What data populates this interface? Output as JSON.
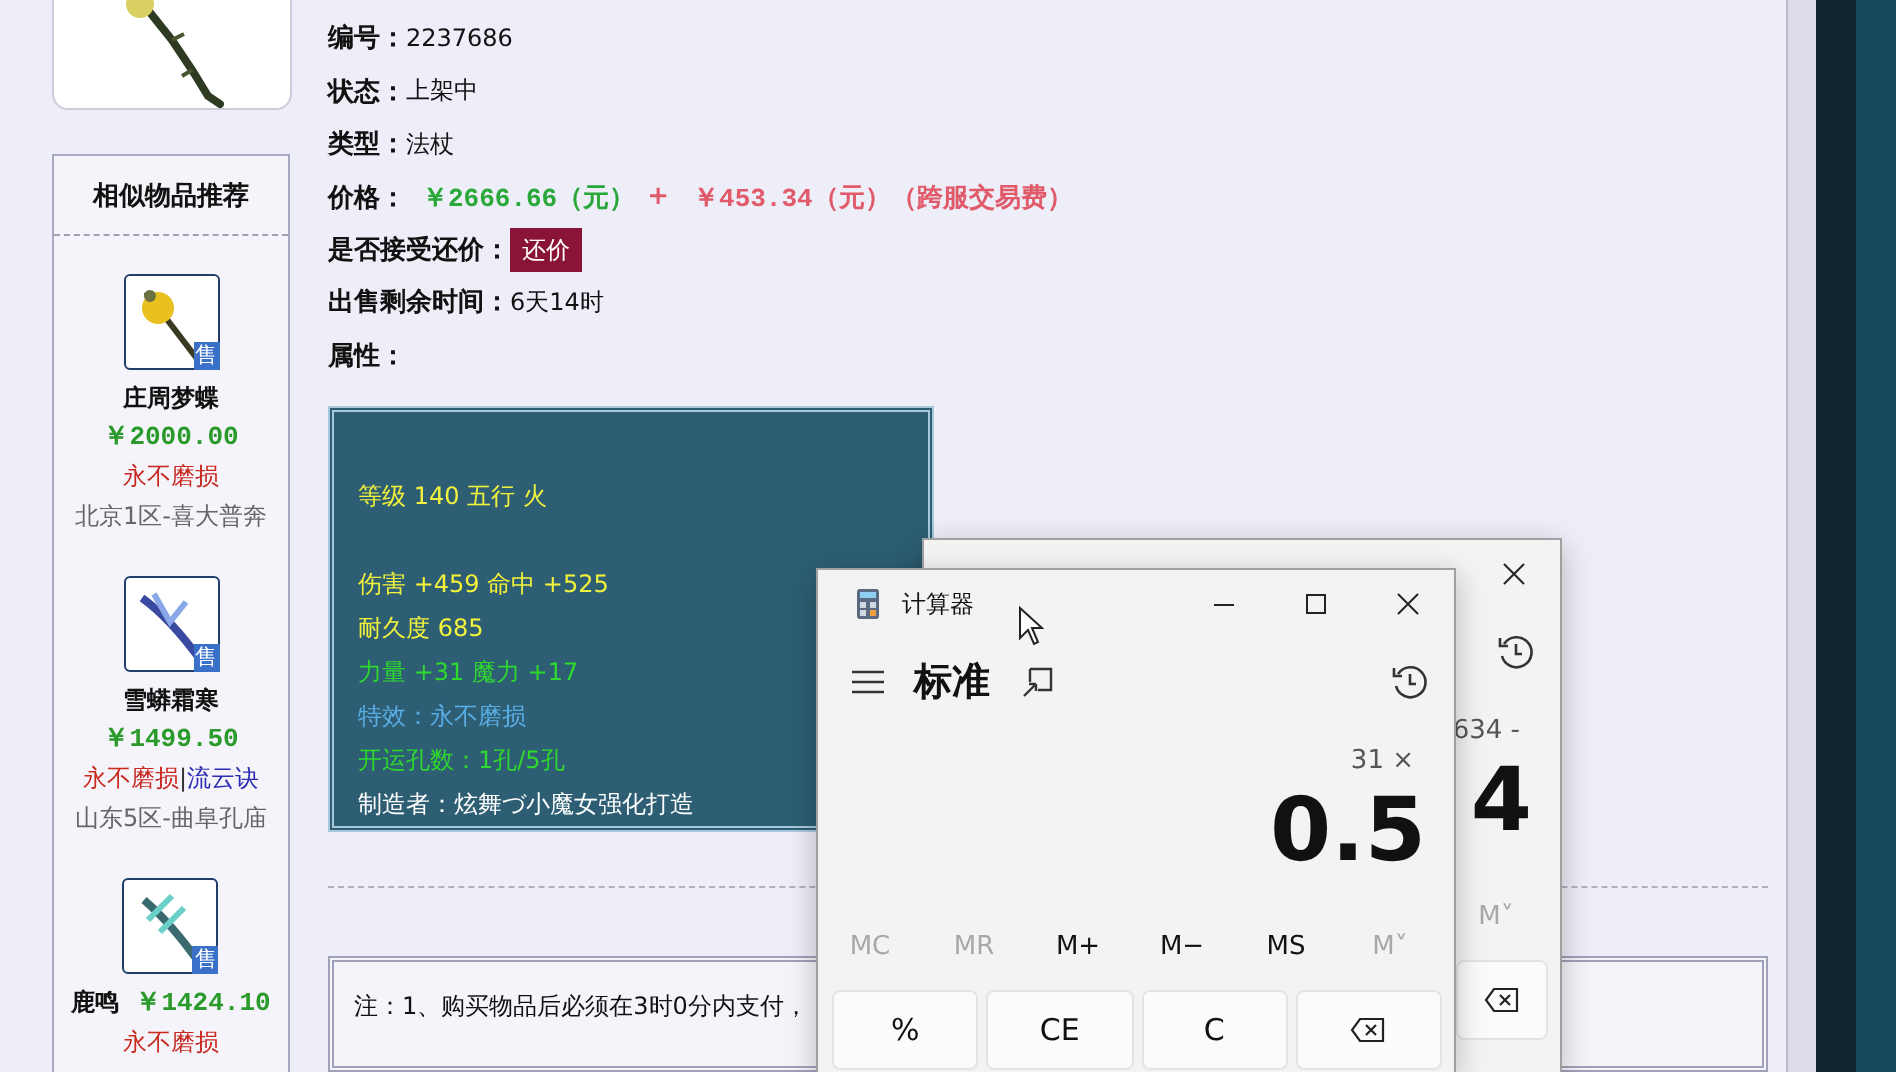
{
  "recommendations": {
    "title": "相似物品推荐",
    "items": [
      {
        "kind": "stacked",
        "name": "庄周梦蝶",
        "price": "￥2000.00",
        "badge": "售",
        "tags": [
          {
            "text": "永不磨损",
            "color": "#c8281e"
          }
        ],
        "server": "北京1区-喜大普奔"
      },
      {
        "kind": "stacked",
        "name": "雪蟒霜寒",
        "price": "￥1499.50",
        "badge": "售",
        "tags": [
          {
            "text": "永不磨损",
            "color": "#c8281e"
          },
          {
            "text": "|",
            "color": "#333333"
          },
          {
            "text": "流云诀",
            "color": "#2b2bb4"
          }
        ],
        "server": "山东5区-曲阜孔庙"
      },
      {
        "kind": "inline",
        "name": "鹿鸣",
        "price": "￥1424.10",
        "badge": "售",
        "tags": [
          {
            "text": "永不磨损",
            "color": "#c8281e"
          }
        ]
      }
    ]
  },
  "details": {
    "fields": [
      {
        "kind": "text",
        "label": "编号：",
        "value": "2237686"
      },
      {
        "kind": "text",
        "label": "状态：",
        "value": " 上架中"
      },
      {
        "kind": "text",
        "label": "类型：",
        "value": "法杖"
      },
      {
        "kind": "price",
        "label": "价格：",
        "price": "￥2666.66（元）",
        "plus": "+",
        "fee": "￥453.34（元）（跨服交易费）"
      },
      {
        "kind": "button",
        "label": "是否接受还价：",
        "button": "还价"
      },
      {
        "kind": "text",
        "label": "出售剩余时间：",
        "value": "6天14时"
      },
      {
        "kind": "label",
        "label": "属性："
      }
    ]
  },
  "attributes": {
    "lines": [
      {
        "text": "等级 140 五行 火",
        "color": "#f2f23c",
        "gap_before": false
      },
      {
        "text": "伤害 +459 命中 +525",
        "color": "#f2f23c",
        "gap_before": true
      },
      {
        "text": "耐久度 685",
        "color": "#f2f23c",
        "gap_before": false
      },
      {
        "text": "力量 +31 魔力 +17",
        "color": "#2ed82e",
        "gap_before": false
      },
      {
        "text": "特效：永不磨损",
        "color": "#5aaee6",
        "gap_before": false
      },
      {
        "text": "开运孔数：1孔/5孔",
        "color": "#2ed82e",
        "gap_before": false
      },
      {
        "text": "制造者：炫舞づ小魔女强化打造",
        "color": "#ffffff",
        "gap_before": false
      }
    ]
  },
  "notes": {
    "lines": [
      "注：1、购买物品后必须在3时0分内支付，"
    ]
  },
  "calculator_back": {
    "expression": "634 -",
    "display": "4",
    "memory": [
      {
        "label": "M˅",
        "disabled": true
      }
    ],
    "keys": [
      {
        "kind": "backspace"
      }
    ]
  },
  "calculator_front": {
    "title": "计算器",
    "mode": "标准",
    "expression": "31 ×",
    "display": "0.5",
    "memory": [
      {
        "label": "MC",
        "disabled": true
      },
      {
        "label": "MR",
        "disabled": true
      },
      {
        "label": "M+",
        "disabled": false
      },
      {
        "label": "M−",
        "disabled": false
      },
      {
        "label": "MS",
        "disabled": false
      },
      {
        "label": "M˅",
        "disabled": true
      }
    ],
    "keys": [
      {
        "kind": "text",
        "label": "%"
      },
      {
        "kind": "text",
        "label": "CE"
      },
      {
        "kind": "text",
        "label": "C"
      },
      {
        "kind": "backspace"
      }
    ]
  }
}
